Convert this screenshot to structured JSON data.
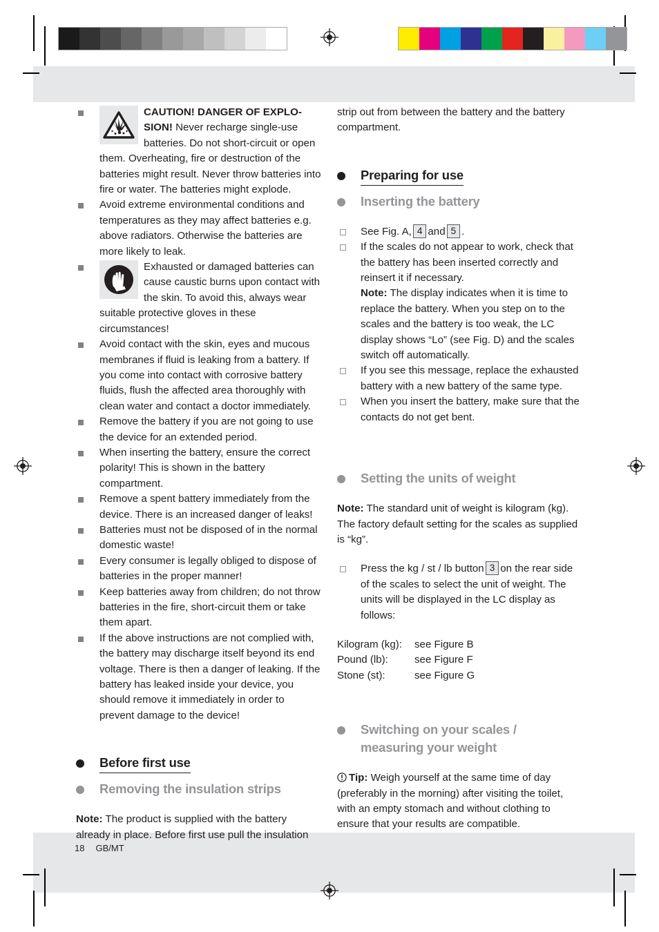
{
  "page": {
    "number": "18",
    "language_code": "GB/MT"
  },
  "calibration": {
    "grayscale_label": "grayscale-calibration-bar",
    "grayscale_swatches": [
      "#1a1a1a",
      "#333333",
      "#4d4d4d",
      "#666666",
      "#808080",
      "#999999",
      "#a8a8a8",
      "#bfbfbf",
      "#d4d4d4",
      "#ececec",
      "#ffffff"
    ],
    "color_label": "color-calibration-bar",
    "color_swatches": [
      "#ffec00",
      "#e5007e",
      "#00a0e3",
      "#2e3192",
      "#00a14b",
      "#e52420",
      "#231f20",
      "#fbf0a0",
      "#f49ac1",
      "#6dcff6",
      "#939598"
    ]
  },
  "left_column": {
    "warnings": [
      {
        "icon": "explosion-warning-icon",
        "strong": "CAUTION! DANGER OF EXPLO-SION!",
        "text": " Never recharge single-use batteries. Do not short-circuit or open them. Overheating, fire or destruction of the batteries might result. Never throw batteries into fire or water. The batteries might explode."
      },
      {
        "icon": null,
        "strong": "",
        "text": "Avoid extreme environmental conditions and temperatures as they may affect batteries e.g. above radiators. Otherwise the batteries are more likely to leak."
      },
      {
        "icon": "protective-gloves-icon",
        "strong": "",
        "text": "Exhausted or damaged batteries can cause caustic burns upon contact with the skin. To avoid this, always wear suitable protective gloves in these circumstances!"
      },
      {
        "icon": null,
        "strong": "",
        "text": "Avoid contact with the skin, eyes and mucous membranes if fluid is leaking from a battery. If you come into contact with corrosive battery fluids, flush the affected area thoroughly with clean water and contact a doctor immediately."
      },
      {
        "icon": null,
        "strong": "",
        "text": "Remove the battery if you are not going to use the device for an extended period."
      },
      {
        "icon": null,
        "strong": "",
        "text": "When inserting the battery, ensure the correct polarity! This is shown in the battery compartment."
      },
      {
        "icon": null,
        "strong": "",
        "text": "Remove a spent battery immediately from the device. There is an increased danger of leaks!"
      },
      {
        "icon": null,
        "strong": "",
        "text": "Batteries must not be disposed of in the normal domestic waste!"
      },
      {
        "icon": null,
        "strong": "",
        "text": "Every consumer is legally obliged to dispose of batteries in the proper manner!"
      },
      {
        "icon": null,
        "strong": "",
        "text": "Keep batteries away from children; do not throw batteries in the fire, short-circuit them or take them apart."
      },
      {
        "icon": null,
        "strong": "",
        "text": "If the above instructions are not complied with, the battery may discharge itself beyond its end voltage. There is then a danger of leaking. If the battery has leaked inside your device, you should remove it immediately in order to prevent damage to the device!"
      }
    ],
    "heading_before_first_use": "Before first use",
    "heading_removing_insulation": "Removing the insulation strips",
    "note_label": "Note:",
    "note_text": " The product is supplied with the battery already in place. Before first use pull the insulation"
  },
  "right_column": {
    "continuation_text": "strip out from between the battery and the battery compartment.",
    "heading_preparing": "Preparing for use",
    "heading_inserting_battery": "Inserting the battery",
    "inserting_items": {
      "see_fig_prefix": "See Fig. A,",
      "ref_4": "4",
      "see_fig_and": "and",
      "ref_5": "5",
      "see_fig_suffix": ".",
      "item2_text": "If the scales do not appear to work, check that the battery has been inserted correctly and reinsert it if necessary.",
      "item2_note_label": "Note:",
      "item2_note_text": " The display indicates when it is time to replace the battery. When you step on to the scales and the battery is too weak, the LC display shows “Lo” (see Fig. D) and the scales switch off automatically.",
      "item3_text": "If you see this message, replace the exhausted battery with a new battery of the same type.",
      "item4_text": "When you insert the battery, make sure that the contacts do not get bent."
    },
    "heading_setting_units": "Setting the units of weight",
    "units_note_label": "Note:",
    "units_note_text": " The standard unit of weight is kilogram (kg). The factory default setting for the scales as supplied is “kg”.",
    "press_button_prefix": "Press the kg / st / lb button",
    "press_button_ref": "3",
    "press_button_suffix": "on the rear side of the scales to select the unit of weight. The units will be displayed in the LC display as follows:",
    "units_table": [
      {
        "unit": "Kilogram (kg):",
        "figure": "see Figure B"
      },
      {
        "unit": "Pound (lb):",
        "figure": "see Figure F"
      },
      {
        "unit": "Stone (st):",
        "figure": "see Figure G"
      }
    ],
    "heading_switching_on_line1": "Switching on your scales /",
    "heading_switching_on_line2": "measuring your weight",
    "tip_icon": "exclamation-circle-icon",
    "tip_label": "Tip:",
    "tip_text": " Weigh yourself at the same time of day (preferably in the morning) after visiting the toilet, with an empty stomach and without clothing to ensure that your results are compatible."
  }
}
